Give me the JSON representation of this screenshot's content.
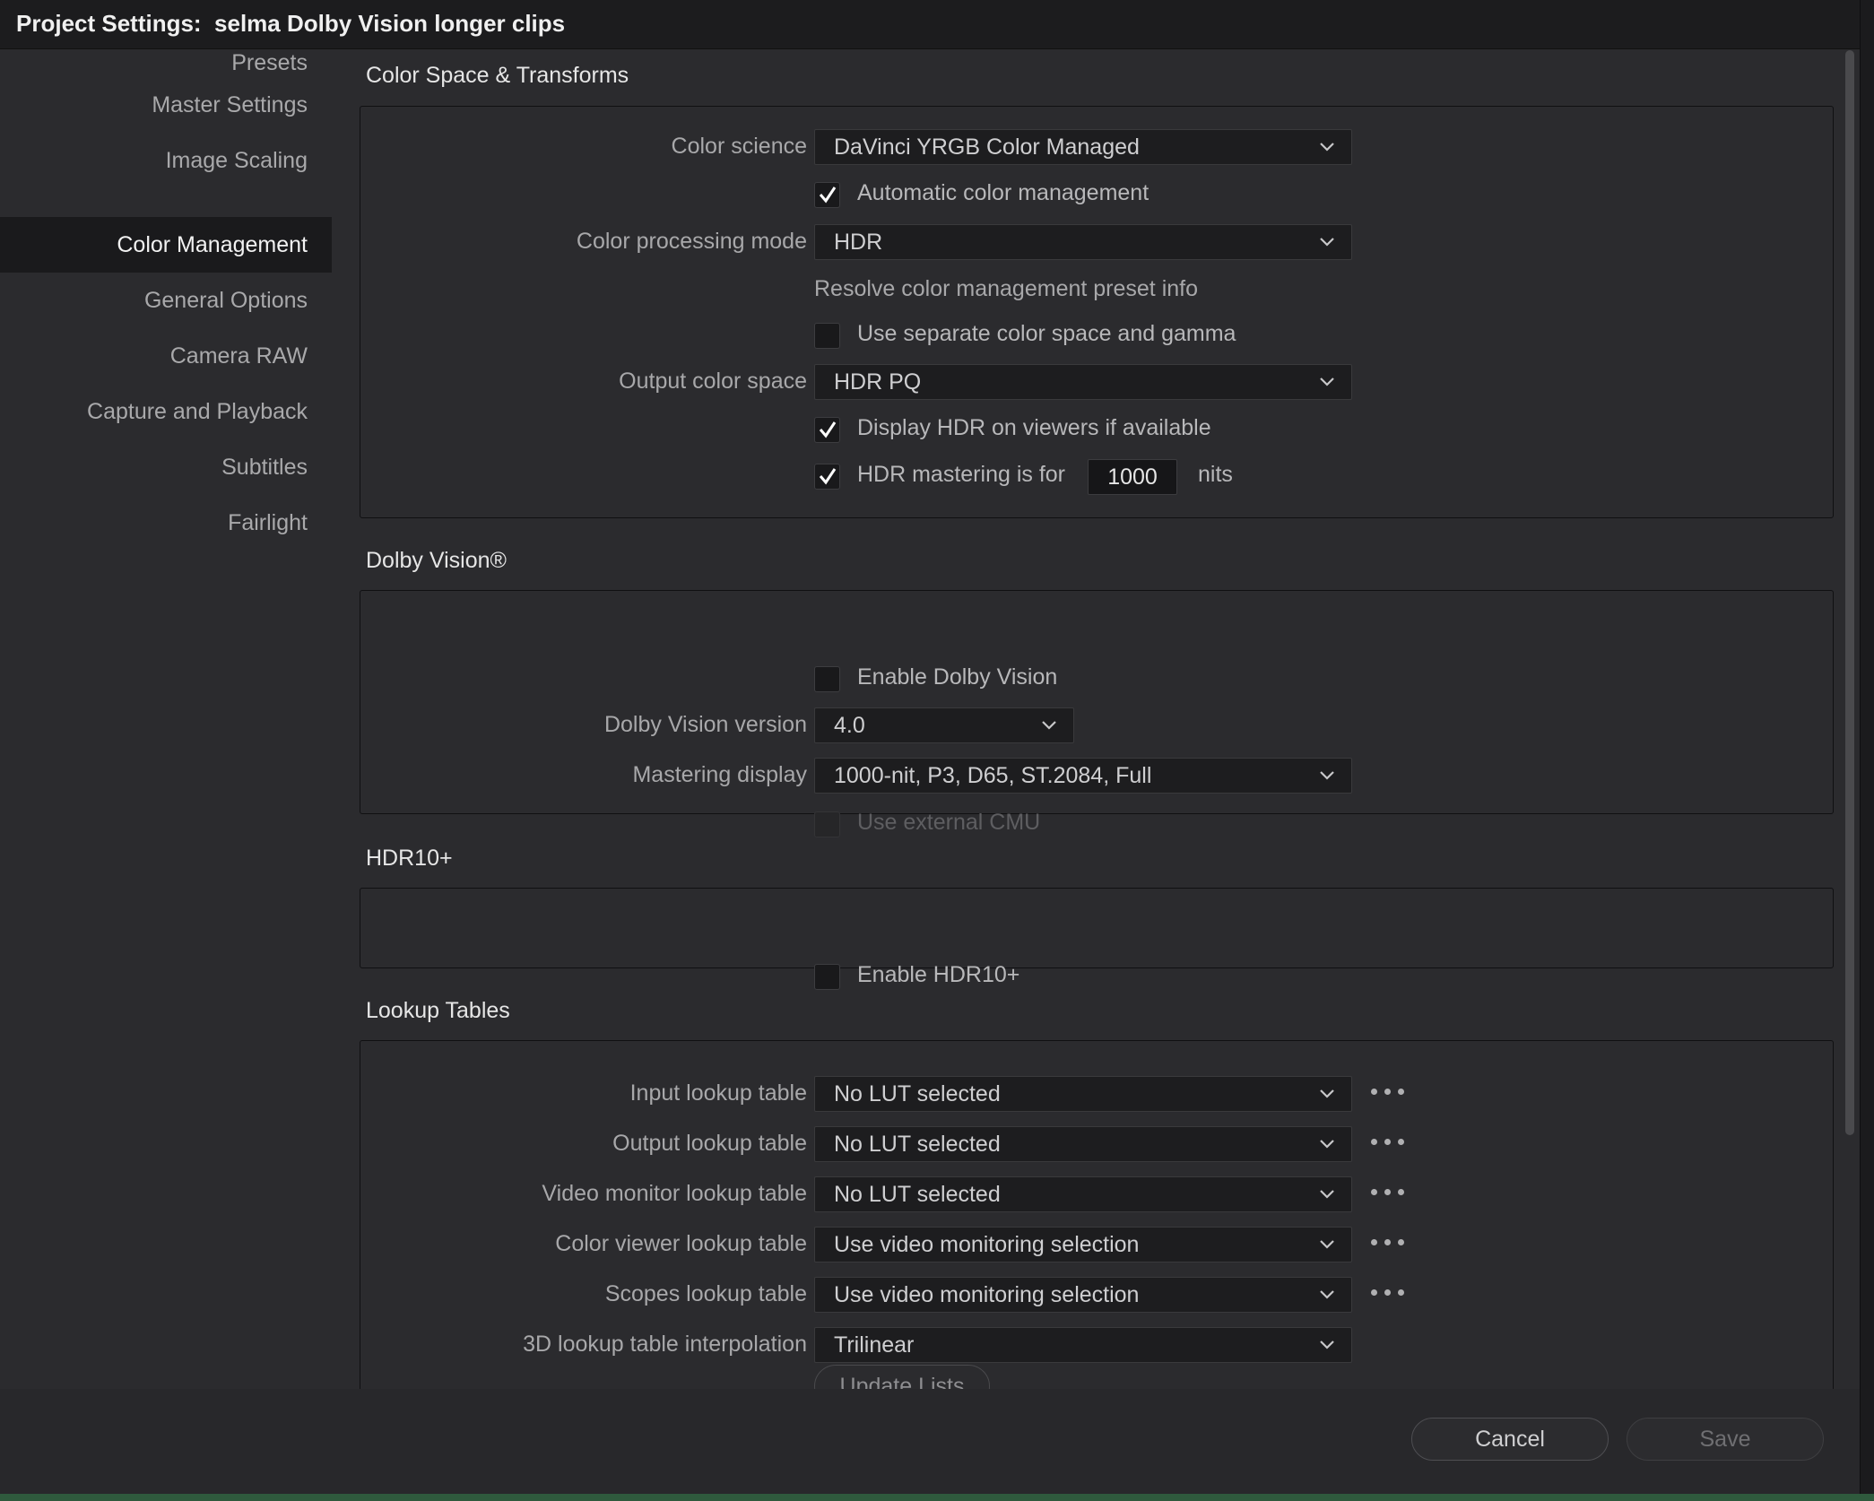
{
  "window": {
    "title": "Project Settings:  selma Dolby Vision longer clips"
  },
  "sidebar": {
    "items": [
      {
        "label": "Presets"
      },
      {
        "label": "Master Settings"
      },
      {
        "label": "Image Scaling"
      },
      {
        "label": "Color Management",
        "active": true
      },
      {
        "label": "General Options"
      },
      {
        "label": "Camera RAW"
      },
      {
        "label": "Capture and Playback"
      },
      {
        "label": "Subtitles"
      },
      {
        "label": "Fairlight"
      }
    ]
  },
  "color_space": {
    "title": "Color Space & Transforms",
    "color_science_label": "Color science",
    "color_science_value": "DaVinci YRGB Color Managed",
    "auto_cm_label": "Automatic color management",
    "auto_cm_checked": true,
    "processing_mode_label": "Color processing mode",
    "processing_mode_value": "HDR",
    "preset_info": "Resolve color management preset info",
    "separate_label": "Use separate color space and gamma",
    "separate_checked": false,
    "output_space_label": "Output color space",
    "output_space_value": "HDR PQ",
    "display_hdr_label": "Display HDR on viewers if available",
    "display_hdr_checked": true,
    "mastering_label": "HDR mastering is for",
    "mastering_checked": true,
    "mastering_nits": "1000",
    "mastering_unit": "nits"
  },
  "dolby": {
    "title": "Dolby Vision®",
    "enable_label": "Enable Dolby Vision",
    "enable_checked": false,
    "version_label": "Dolby Vision version",
    "version_value": "4.0",
    "mastering_display_label": "Mastering display",
    "mastering_display_value": "1000-nit, P3, D65, ST.2084, Full",
    "external_cmu_label": "Use external CMU",
    "external_cmu_disabled": true
  },
  "hdr10": {
    "title": "HDR10+",
    "enable_label": "Enable HDR10+",
    "enable_checked": false
  },
  "lut": {
    "title": "Lookup Tables",
    "rows": [
      {
        "label": "Input lookup table",
        "value": "No LUT selected"
      },
      {
        "label": "Output lookup table",
        "value": "No LUT selected"
      },
      {
        "label": "Video monitor lookup table",
        "value": "No LUT selected"
      },
      {
        "label": "Color viewer lookup table",
        "value": "Use video monitoring selection"
      },
      {
        "label": "Scopes lookup table",
        "value": "Use video monitoring selection"
      }
    ],
    "interp_label": "3D lookup table interpolation",
    "interp_value": "Trilinear",
    "update_label": "Update Lists"
  },
  "footer": {
    "cancel_label": "Cancel",
    "save_label": "Save"
  },
  "colors": {
    "background": "#2b2b2e",
    "field": "#1d1d1f",
    "active_sidebar": "#1a1a1c"
  }
}
